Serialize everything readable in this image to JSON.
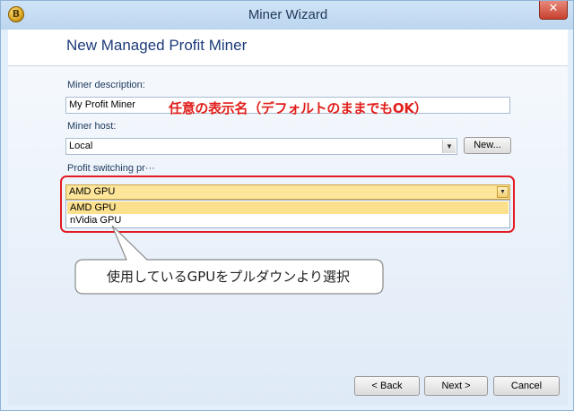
{
  "window": {
    "title": "Miner Wizard",
    "app_icon_glyph": "B",
    "close_glyph": "✕"
  },
  "header": {
    "page_title": "New Managed Profit Miner"
  },
  "form": {
    "description_label": "Miner description:",
    "description_value": "My Profit Miner",
    "host_label": "Miner host:",
    "host_value": "Local",
    "new_button": "New...",
    "profit_label": "Profit switching pr···",
    "profit_value": "AMD GPU",
    "options": [
      "AMD GPU",
      "nVidia GPU"
    ],
    "combo_arrow_glyph": "▼"
  },
  "annotations": {
    "description_note": "任意の表示名（デフォルトのままでもOK）",
    "callout": "使用しているGPUをプルダウンより選択",
    "note_color": "#e0201c",
    "highlight_color": "#e31b23"
  },
  "footer": {
    "back": "< Back",
    "next": "Next >",
    "cancel": "Cancel"
  }
}
